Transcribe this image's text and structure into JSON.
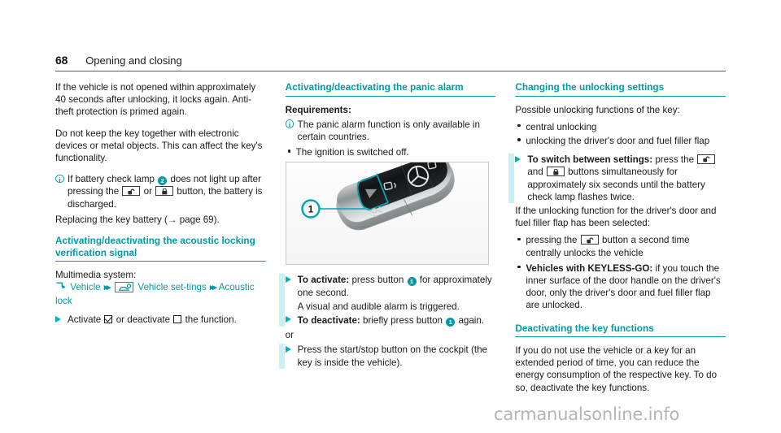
{
  "header": {
    "page_number": "68",
    "title": "Opening and closing"
  },
  "left_column": {
    "paragraph_1": "If the vehicle is not opened within approximately 40 seconds after unlocking, it locks again. Anti-theft protection is primed again.",
    "paragraph_2": "Do not keep the key together with electronic devices or metal objects. This can affect the key's functionality.",
    "note_battery": {
      "text_before_badge": "If battery check lamp",
      "badge": "2",
      "text_after_badge": "does not light up after pressing the",
      "conjunction": "or",
      "text_tail": "button, the battery is discharged."
    },
    "paragraph_3": "Replacing the key battery (→ page 69).",
    "section_heading": "Activating/deactivating the acoustic locking verification signal",
    "multimedia_label": "Multimedia system:",
    "menu_path": {
      "item_1": "Vehicle",
      "item_2": "Vehicle set-tings",
      "item_3": "Acoustic lock"
    },
    "action_activate": {
      "text_1": "Activate",
      "text_2": "or deactivate",
      "text_3": "the function."
    }
  },
  "middle_column": {
    "section_heading": "Activating/deactivating the panic alarm",
    "requirements_heading": "Requirements:",
    "note_countries": "The panic alarm function is only available in certain countries.",
    "bullet_ignition": "The ignition is switched off.",
    "figure": {
      "caption_badge": "1",
      "alt": "Mercedes-Benz key fob with panic alarm button highlighted"
    },
    "action_activate": {
      "label": "To activate:",
      "text_before_badge": "press button",
      "badge": "1",
      "text_after_badge": "for approximately one second."
    },
    "alarm_note": "A visual and audible alarm is triggered.",
    "action_deactivate": {
      "label": "To deactivate:",
      "text_before_badge": "briefly press button",
      "badge": "1",
      "text_after_badge": "again."
    },
    "or_label": "or",
    "action_start_stop": "Press the start/stop button on the cockpit (the key is inside the vehicle)."
  },
  "right_column": {
    "section_heading": "Changing the unlocking settings",
    "intro": "Possible unlocking functions of the key:",
    "bullet_central": "central unlocking",
    "bullet_driver_door": "unlocking the driver's door and fuel filler flap",
    "action_switch": {
      "label": "To switch between settings:",
      "text_before_icons": "press the",
      "conjunction": "and",
      "text_after_icons": "buttons simultaneously for approximately six seconds until the battery check lamp flashes twice."
    },
    "selected_intro": "If the unlocking function for the driver's door and fuel filler flap has been selected:",
    "bullet_second_press": {
      "text_before_icon": "pressing the",
      "text_after_icon": "button a second time centrally unlocks the vehicle"
    },
    "bullet_keyless": {
      "label": "Vehicles with KEYLESS-GO:",
      "text": "if you touch the inner surface of the door handle on the driver's door, only the driver's door and fuel filler flap are unlocked."
    },
    "section_heading_2": "Deactivating the key functions",
    "paragraph_deactivate": "If you do not use the vehicle or a key for an extended period of time, you can reduce the energy consumption of the respective key. To do so, deactivate the key functions."
  },
  "watermark": {
    "text": "carmanualsonline.info"
  },
  "colors": {
    "teal": "#009BA4",
    "teal_light": "#C9F0F2",
    "triangle": "#00B2B8",
    "text": "#1a1a1a",
    "watermark": "#b4b4b4"
  }
}
